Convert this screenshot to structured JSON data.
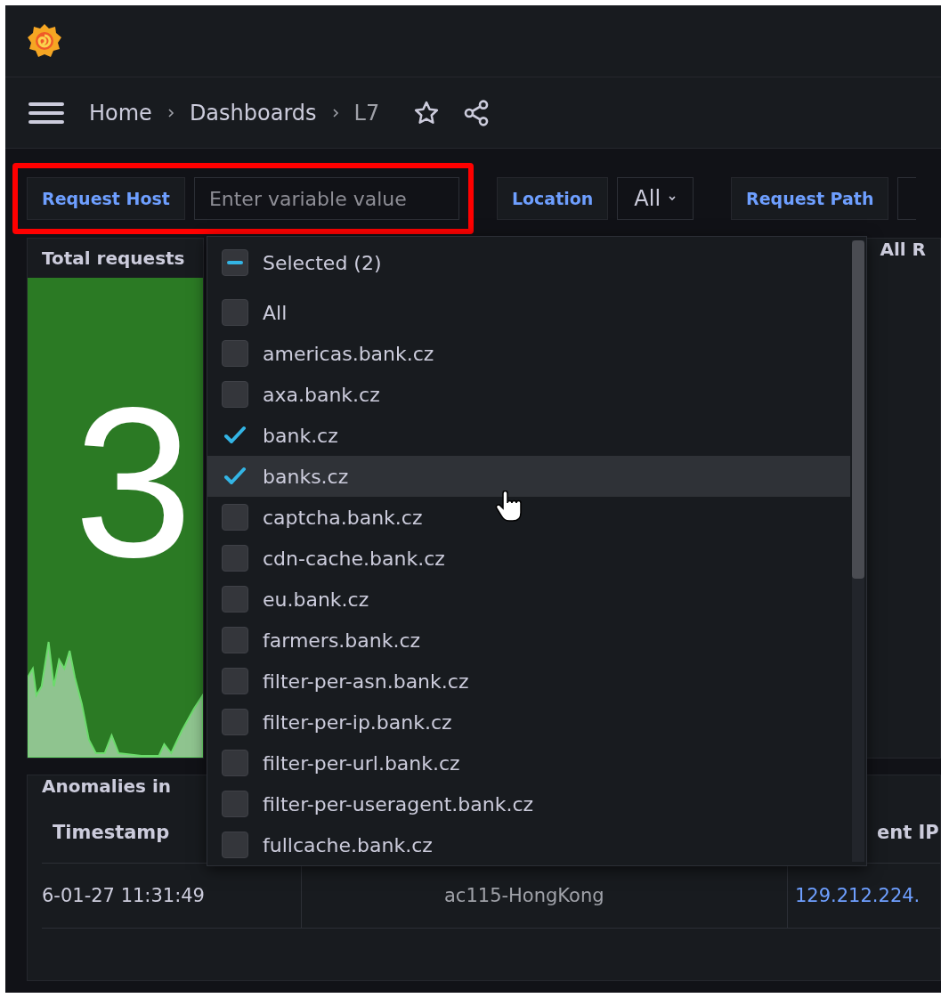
{
  "breadcrumbs": [
    "Home",
    "Dashboards",
    "L7"
  ],
  "variables": [
    {
      "label": "Request Host",
      "kind": "text",
      "placeholder": "Enter variable value",
      "highlighted": true
    },
    {
      "label": "Location",
      "kind": "select",
      "value": "All",
      "highlighted": false
    },
    {
      "label": "Request Path",
      "kind": "cut",
      "highlighted": false
    }
  ],
  "dropdown": {
    "summary": "Selected (2)",
    "indeterminate": true,
    "options": [
      {
        "label": "All",
        "checked": false,
        "hovered": false
      },
      {
        "label": "americas.bank.cz",
        "checked": false,
        "hovered": false
      },
      {
        "label": "axa.bank.cz",
        "checked": false,
        "hovered": false
      },
      {
        "label": "bank.cz",
        "checked": true,
        "hovered": false
      },
      {
        "label": "banks.cz",
        "checked": true,
        "hovered": true
      },
      {
        "label": "captcha.bank.cz",
        "checked": false,
        "hovered": false
      },
      {
        "label": "cdn-cache.bank.cz",
        "checked": false,
        "hovered": false
      },
      {
        "label": "eu.bank.cz",
        "checked": false,
        "hovered": false
      },
      {
        "label": "farmers.bank.cz",
        "checked": false,
        "hovered": false
      },
      {
        "label": "filter-per-asn.bank.cz",
        "checked": false,
        "hovered": false
      },
      {
        "label": "filter-per-ip.bank.cz",
        "checked": false,
        "hovered": false
      },
      {
        "label": "filter-per-url.bank.cz",
        "checked": false,
        "hovered": false
      },
      {
        "label": "filter-per-useragent.bank.cz",
        "checked": false,
        "hovered": false
      },
      {
        "label": "fullcache.bank.cz",
        "checked": false,
        "hovered": false
      }
    ]
  },
  "stat_panel": {
    "title": "Total requests",
    "value": "3"
  },
  "side_panel": {
    "title": "All R"
  },
  "table_panel": {
    "title": "Anomalies in",
    "columns": [
      {
        "heading": "Timestamp"
      },
      {},
      {
        "heading": "ent IP"
      }
    ],
    "rows": [
      [
        "6-01-27 11:31:49",
        "ac115-HongKong",
        "129.212.224."
      ]
    ]
  }
}
